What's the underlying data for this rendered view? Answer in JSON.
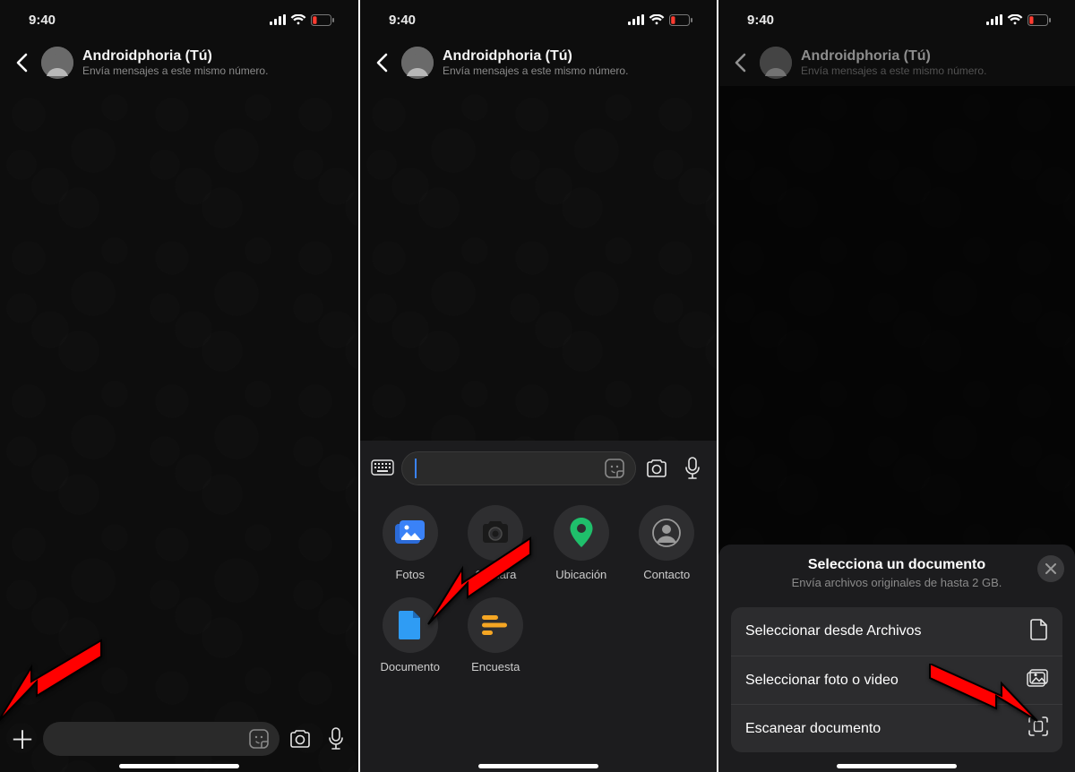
{
  "status": {
    "time": "9:40"
  },
  "chat": {
    "title": "Androidphoria (Tú)",
    "subtitle": "Envía mensajes a este mismo número."
  },
  "attachments": {
    "items": [
      {
        "label": "Fotos",
        "icon": "photos",
        "color": "#3a82f7"
      },
      {
        "label": "Cámara",
        "icon": "camera",
        "color": "#ffffff"
      },
      {
        "label": "Ubicación",
        "icon": "location",
        "color": "#1fbf6b"
      },
      {
        "label": "Contacto",
        "icon": "contact",
        "color": "#bfbfbf"
      },
      {
        "label": "Documento",
        "icon": "document",
        "color": "#2f9cf4"
      },
      {
        "label": "Encuesta",
        "icon": "poll",
        "color": "#f5a623"
      }
    ]
  },
  "sheet": {
    "title": "Selecciona un documento",
    "subtitle": "Envía archivos originales de hasta 2 GB.",
    "rows": [
      {
        "label": "Seleccionar desde Archivos",
        "icon": "file"
      },
      {
        "label": "Seleccionar foto o video",
        "icon": "gallery"
      },
      {
        "label": "Escanear documento",
        "icon": "scan"
      }
    ]
  }
}
